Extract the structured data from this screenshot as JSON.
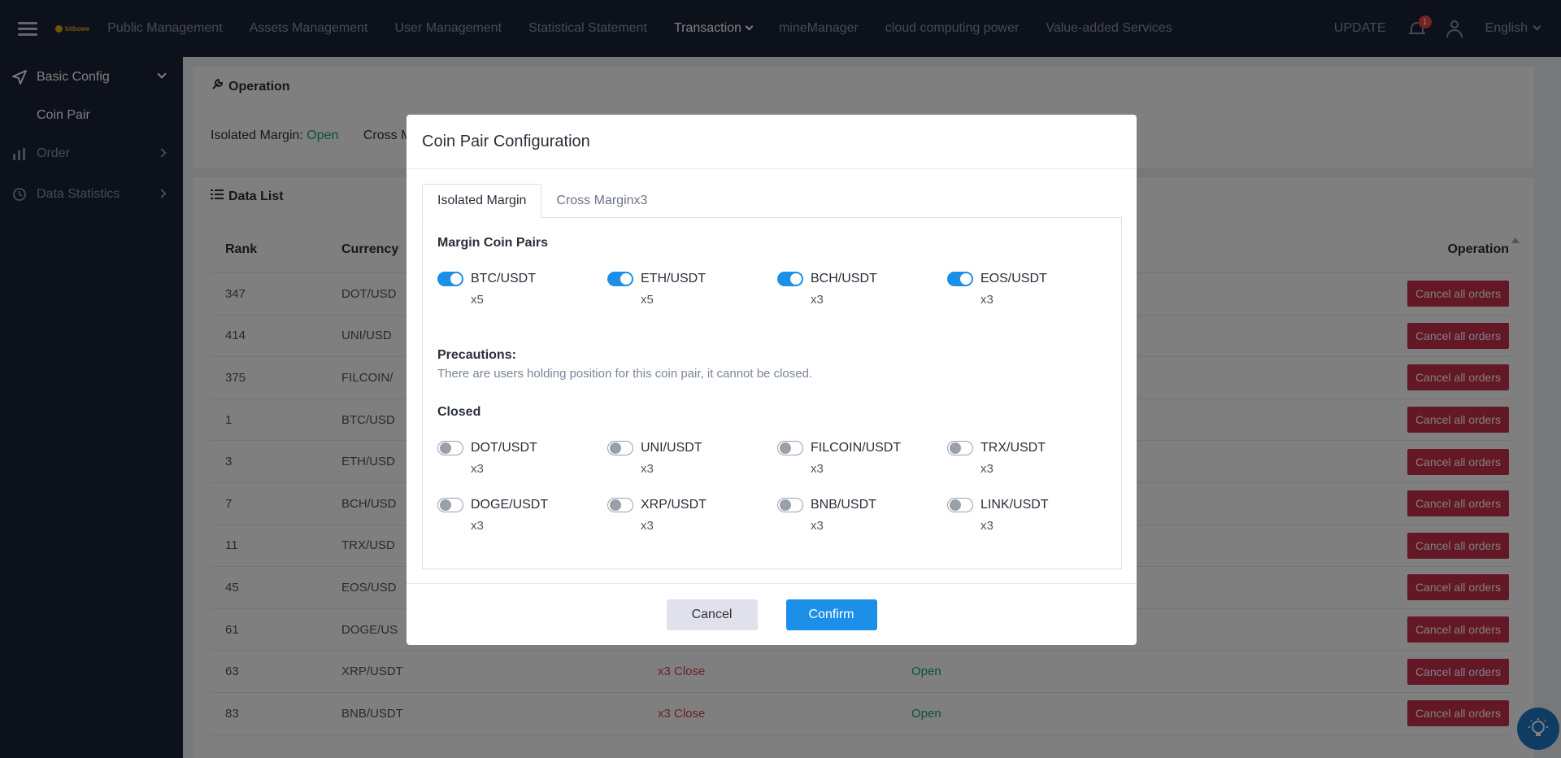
{
  "topbar": {
    "logo_text": "bitbowe",
    "nav": [
      "Public Management",
      "Assets Management",
      "User Management",
      "Statistical Statement",
      "Transaction",
      "mineManager",
      "cloud computing power",
      "Value-added Services"
    ],
    "update_label": "UPDATE",
    "notification_count": "1",
    "language": "English"
  },
  "sidebar": {
    "basic_config": "Basic Config",
    "coin_pair": "Coin Pair",
    "order": "Order",
    "data_statistics": "Data Statistics"
  },
  "operation": {
    "title": "Operation",
    "isolated_label": "Isolated Margin: ",
    "isolated_value": "Open",
    "cross_label": "Cross Ma"
  },
  "data_list": {
    "title": "Data List",
    "headers": {
      "rank": "Rank",
      "currency": "Currency",
      "operation": "Operation"
    },
    "rows": [
      {
        "rank": "347",
        "currency": "DOT/USD",
        "iso": "",
        "cross": ""
      },
      {
        "rank": "414",
        "currency": "UNI/USD",
        "iso": "",
        "cross": ""
      },
      {
        "rank": "375",
        "currency": "FILCOIN/",
        "iso": "",
        "cross": ""
      },
      {
        "rank": "1",
        "currency": "BTC/USD",
        "iso": "",
        "cross": ""
      },
      {
        "rank": "3",
        "currency": "ETH/USD",
        "iso": "",
        "cross": ""
      },
      {
        "rank": "7",
        "currency": "BCH/USD",
        "iso": "",
        "cross": ""
      },
      {
        "rank": "11",
        "currency": "TRX/USD",
        "iso": "",
        "cross": ""
      },
      {
        "rank": "45",
        "currency": "EOS/USD",
        "iso": "",
        "cross": ""
      },
      {
        "rank": "61",
        "currency": "DOGE/US",
        "iso": "",
        "cross": ""
      },
      {
        "rank": "63",
        "currency": "XRP/USDT",
        "iso": "x3 Close",
        "cross": "Open"
      },
      {
        "rank": "83",
        "currency": "BNB/USDT",
        "iso": "x3 Close",
        "cross": "Open"
      }
    ],
    "cancel_all_label": "Cancel all orders"
  },
  "modal": {
    "title": "Coin Pair Configuration",
    "tabs": [
      "Isolated Margin",
      "Cross Marginx3"
    ],
    "margin_section": "Margin Coin Pairs",
    "margin_pairs": [
      {
        "name": "BTC/USDT",
        "lev": "x5",
        "on": true
      },
      {
        "name": "ETH/USDT",
        "lev": "x5",
        "on": true
      },
      {
        "name": "BCH/USDT",
        "lev": "x3",
        "on": true
      },
      {
        "name": "EOS/USDT",
        "lev": "x3",
        "on": true
      }
    ],
    "precautions_title": "Precautions:",
    "precautions_text": "There are users holding position for this coin pair, it cannot be closed.",
    "closed_section": "Closed",
    "closed_pairs": [
      {
        "name": "DOT/USDT",
        "lev": "x3",
        "on": false
      },
      {
        "name": "UNI/USDT",
        "lev": "x3",
        "on": false
      },
      {
        "name": "FILCOIN/USDT",
        "lev": "x3",
        "on": false
      },
      {
        "name": "TRX/USDT",
        "lev": "x3",
        "on": false
      },
      {
        "name": "DOGE/USDT",
        "lev": "x3",
        "on": false
      },
      {
        "name": "XRP/USDT",
        "lev": "x3",
        "on": false
      },
      {
        "name": "BNB/USDT",
        "lev": "x3",
        "on": false
      },
      {
        "name": "LINK/USDT",
        "lev": "x3",
        "on": false
      }
    ],
    "cancel_label": "Cancel",
    "confirm_label": "Confirm"
  },
  "colors": {
    "nav_bg": "#1a2236",
    "accent_blue": "#1c8fe8",
    "danger_red": "#c9314a",
    "open_green": "#18a570"
  }
}
